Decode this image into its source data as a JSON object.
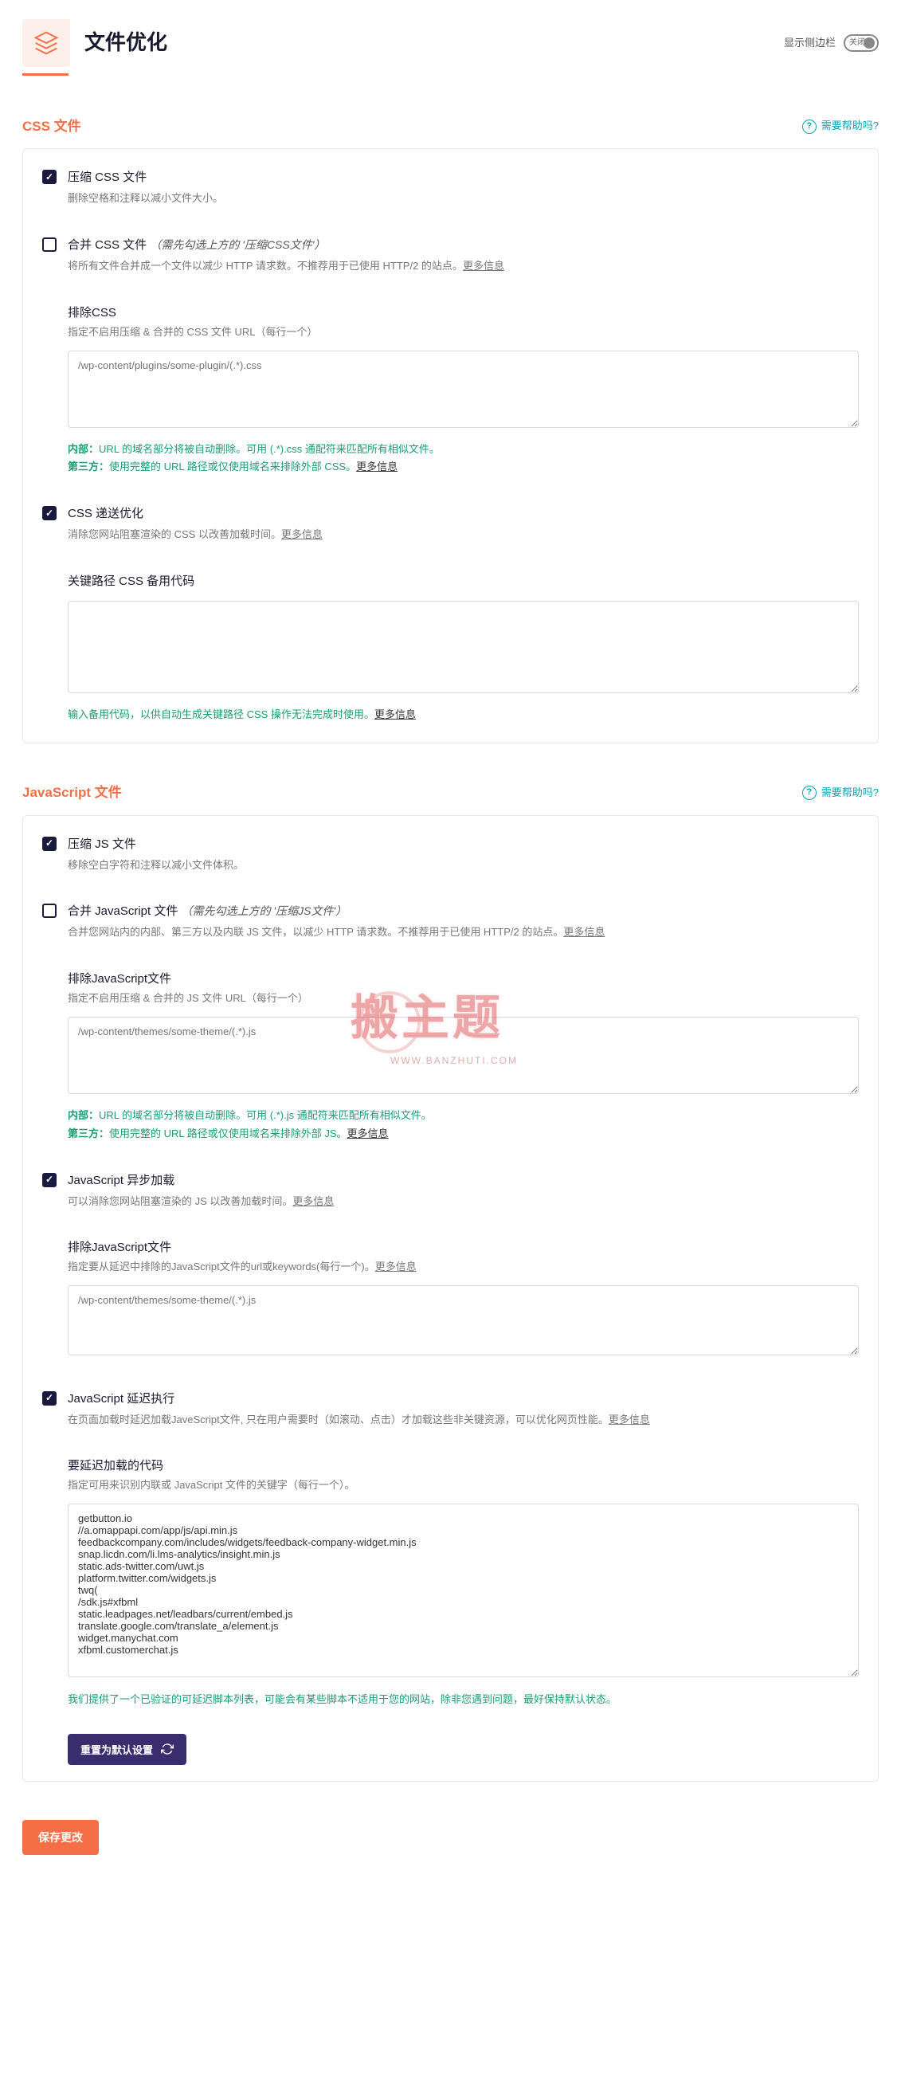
{
  "header": {
    "title": "文件优化",
    "sidebar_label": "显示侧边栏",
    "toggle_state": "关闭"
  },
  "sections": {
    "css": {
      "title": "CSS 文件",
      "help": "需要帮助吗?",
      "minify": {
        "title": "压缩 CSS 文件",
        "desc": "删除空格和注释以减小文件大小。"
      },
      "combine": {
        "title": "合并 CSS 文件",
        "hint": "（需先勾选上方的 '压缩CSS文件'）",
        "desc": "将所有文件合并成一个文件以减少 HTTP 请求数。不推荐用于已使用 HTTP/2 的站点。",
        "more": "更多信息"
      },
      "exclude": {
        "title": "排除CSS",
        "desc": "指定不启用压缩 & 合并的 CSS 文件 URL（每行一个）",
        "placeholder": "/wp-content/plugins/some-plugin/(.*).css",
        "note_internal_b": "内部：",
        "note_internal": "URL 的域名部分将被自动删除。可用 (.*).css 通配符来匹配所有相似文件。",
        "note_third_b": "第三方：",
        "note_third": "使用完整的 URL 路径或仅使用域名来排除外部 CSS。",
        "more": "更多信息"
      },
      "optdelivery": {
        "title": "CSS 递送优化",
        "desc": "消除您网站阻塞渲染的 CSS 以改善加载时间。",
        "more": "更多信息"
      },
      "critical": {
        "title": "关键路径 CSS 备用代码",
        "note": "输入备用代码，以供自动生成关键路径 CSS 操作无法完成时使用。",
        "more": "更多信息"
      }
    },
    "js": {
      "title": "JavaScript 文件",
      "help": "需要帮助吗?",
      "minify": {
        "title": "压缩 JS 文件",
        "desc": "移除空白字符和注释以减小文件体积。"
      },
      "combine": {
        "title": "合并 JavaScript 文件",
        "hint": "（需先勾选上方的 '压缩JS文件'）",
        "desc": "合并您网站内的内部、第三方以及内联 JS 文件，以减少 HTTP 请求数。不推荐用于已使用 HTTP/2 的站点。",
        "more": "更多信息"
      },
      "exclude": {
        "title": "排除JavaScript文件",
        "desc": "指定不启用压缩 & 合并的 JS 文件 URL（每行一个）",
        "placeholder": "/wp-content/themes/some-theme/(.*).js",
        "note_internal_b": "内部：",
        "note_internal": "URL 的域名部分将被自动删除。可用 (.*).js 通配符来匹配所有相似文件。",
        "note_third_b": "第三方：",
        "note_third": "使用完整的 URL 路径或仅使用域名来排除外部 JS。",
        "more": "更多信息"
      },
      "defer": {
        "title": "JavaScript 异步加载",
        "desc": "可以消除您网站阻塞渲染的 JS 以改善加载时间。",
        "more": "更多信息"
      },
      "deferex": {
        "title": "排除JavaScript文件",
        "desc": "指定要从延迟中排除的JavaScript文件的url或keywords(每行一个)。",
        "more": "更多信息",
        "placeholder": "/wp-content/themes/some-theme/(.*).js"
      },
      "delay": {
        "title": "JavaScript 延迟执行",
        "desc": "在页面加载时延迟加载JaveScript文件, 只在用户需要时（如滚动、点击）才加载这些非关键资源，可以优化网页性能。",
        "more": "更多信息"
      },
      "delaycode": {
        "title": "要延迟加载的代码",
        "desc": "指定可用来识别内联或 JavaScript 文件的关键字（每行一个）。",
        "value": "getbutton.io\n//a.omappapi.com/app/js/api.min.js\nfeedbackcompany.com/includes/widgets/feedback-company-widget.min.js\nsnap.licdn.com/li.lms-analytics/insight.min.js\nstatic.ads-twitter.com/uwt.js\nplatform.twitter.com/widgets.js\ntwq(\n/sdk.js#xfbml\nstatic.leadpages.net/leadbars/current/embed.js\ntranslate.google.com/translate_a/element.js\nwidget.manychat.com\nxfbml.customerchat.js",
        "note": "我们提供了一个已验证的可延迟脚本列表，可能会有某些脚本不适用于您的网站，除非您遇到问题，最好保持默认状态。"
      },
      "reset": "重置为默认设置"
    }
  },
  "save": "保存更改",
  "watermark": {
    "text": "搬主题",
    "url": "WWW.BANZHUTI.COM"
  }
}
